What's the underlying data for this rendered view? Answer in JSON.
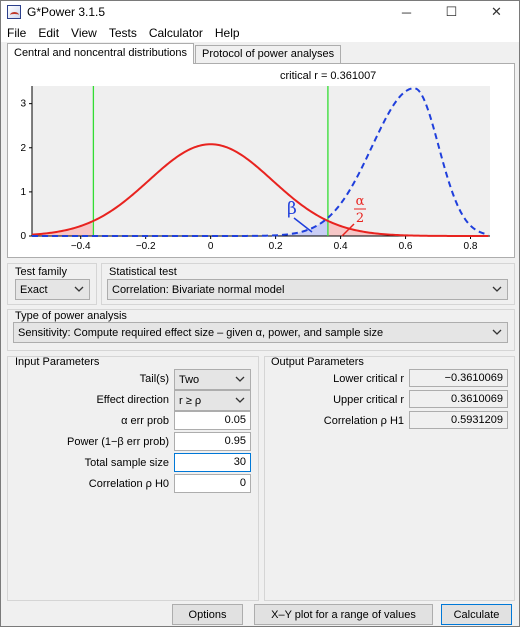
{
  "window": {
    "title": "G*Power 3.1.5"
  },
  "menu": [
    "File",
    "Edit",
    "View",
    "Tests",
    "Calculator",
    "Help"
  ],
  "tabs": [
    "Central and noncentral distributions",
    "Protocol of power analyses"
  ],
  "chart_data": {
    "type": "line",
    "title": "critical r = 0.361007",
    "xlim": [
      -0.55,
      0.86
    ],
    "ylim": [
      0,
      3.4
    ],
    "x_ticks": [
      -0.4,
      -0.2,
      0,
      0.2,
      0.4,
      0.6,
      0.8
    ],
    "x_tick_labels": [
      "−0.4",
      "−0.2",
      "0",
      "0.2",
      "0.4",
      "0.6",
      "0.8"
    ],
    "y_ticks": [
      0,
      1,
      2,
      3
    ],
    "y_tick_labels": [
      "0",
      "1",
      "2",
      "3"
    ],
    "critical_lines": [
      -0.361,
      0.361
    ],
    "series": [
      {
        "style": "solid",
        "color": "#e8231f",
        "mean": 0,
        "peak": 2.08,
        "sd": 0.19
      },
      {
        "style": "dashed",
        "color": "#1f3fdc",
        "mode": 0.627,
        "peak": 3.35,
        "sd_left": 0.13,
        "sd_right": 0.075
      }
    ],
    "annotations": {
      "beta": "β",
      "alpha_num": "α",
      "alpha_den": "2"
    }
  },
  "test_family": {
    "label": "Test family",
    "value": "Exact"
  },
  "statistical_test": {
    "label": "Statistical test",
    "value": "Correlation: Bivariate normal model"
  },
  "power_analysis": {
    "label": "Type of power analysis",
    "value": "Sensitivity: Compute required effect size – given α, power, and sample size"
  },
  "input": {
    "title": "Input Parameters",
    "tails": {
      "label": "Tail(s)",
      "value": "Two"
    },
    "effect_direction": {
      "label": "Effect direction",
      "value": "r ≥ ρ"
    },
    "alpha": {
      "label": "α err prob",
      "value": "0.05"
    },
    "power": {
      "label": "Power (1−β err prob)",
      "value": "0.95"
    },
    "sample": {
      "label": "Total sample size",
      "value": "30"
    },
    "rho_h0": {
      "label": "Correlation ρ H0",
      "value": "0"
    }
  },
  "output": {
    "title": "Output Parameters",
    "lower": {
      "label": "Lower critical r",
      "value": "−0.3610069"
    },
    "upper": {
      "label": "Upper critical r",
      "value": "0.3610069"
    },
    "rho_h1": {
      "label": "Correlation ρ H1",
      "value": "0.5931209"
    }
  },
  "buttons": {
    "options": "Options",
    "xy_plot": "X–Y plot for a range of values",
    "calculate": "Calculate"
  }
}
